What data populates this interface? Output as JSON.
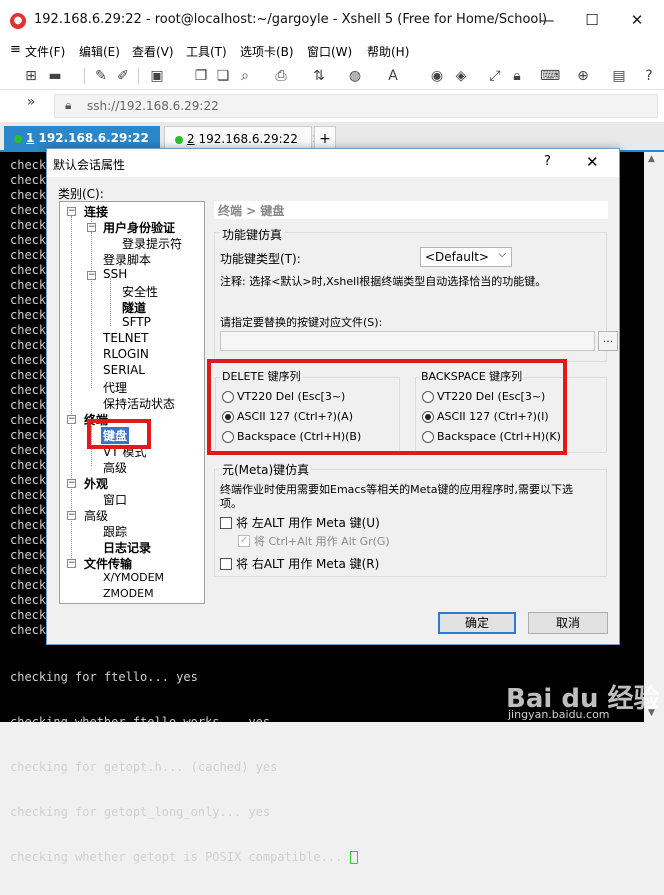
{
  "window": {
    "title": "192.168.6.29:22 - root@localhost:~/gargoyle - Xshell 5 (Free for Home/School)",
    "min": "—",
    "max": "☐",
    "close": "✕"
  },
  "menu": [
    "文件(F)",
    "编辑(E)",
    "查看(V)",
    "工具(T)",
    "选项卡(B)",
    "窗口(W)",
    "帮助(H)"
  ],
  "address": {
    "value": "ssh://192.168.6.29:22"
  },
  "tabs": [
    {
      "num": "1",
      "label": "192.168.6.29:22",
      "close": "✕"
    },
    {
      "num": "2",
      "label": "192.168.6.29:22",
      "close": "✕"
    }
  ],
  "tab_add": "+",
  "terminal": {
    "left_word": "check",
    "bottom_lines": [
      "checking for ftello... yes",
      "checking whether ftello works... yes",
      "checking for getopt.h... (cached) yes",
      "checking for getopt_long_only... yes",
      "checking whether getopt is POSIX compatible... "
    ]
  },
  "dialog": {
    "title": "默认会话属性",
    "help": "?",
    "close": "✕",
    "category_label": "类别(C):",
    "tree": {
      "connect": "连接",
      "auth": "用户身份验证",
      "login_prompt": "登录提示符",
      "login_script": "登录脚本",
      "ssh": "SSH",
      "security": "安全性",
      "tunnel": "隧道",
      "sftp": "SFTP",
      "telnet": "TELNET",
      "rlogin": "RLOGIN",
      "serial": "SERIAL",
      "proxy": "代理",
      "keepalive": "保持活动状态",
      "terminal": "终端",
      "keyboard": "键盘",
      "vt_mode": "VT 模式",
      "advanced1": "高级",
      "appearance": "外观",
      "window": "窗口",
      "advanced": "高级",
      "trace": "跟踪",
      "logging": "日志记录",
      "file_transfer": "文件传输",
      "xymodem": "X/YMODEM",
      "zmodem": "ZMODEM"
    },
    "breadcrumb": "终端 > 键盘",
    "fn_key_group": "功能键仿真",
    "fn_key_type_label": "功能键类型(T):",
    "fn_key_type_value": "<Default>",
    "fn_note": "注释: 选择<默认>时,Xshell根据终端类型自动选择恰当的功能键。",
    "keymap_label": "请指定要替换的按键对应文件(S):",
    "browse": "...",
    "delete_group": "DELETE 键序列",
    "delete_options": [
      "VT220 Del (Esc[3~)",
      "ASCII 127 (Ctrl+?)(A)",
      "Backspace (Ctrl+H)(B)"
    ],
    "backspace_group": "BACKSPACE 键序列",
    "backspace_options": [
      "VT220 Del (Esc[3~)",
      "ASCII 127 (Ctrl+?)(I)",
      "Backspace (Ctrl+H)(K)"
    ],
    "meta_group": "元(Meta)键仿真",
    "meta_note_1": "终端作业时使用需要如Emacs等相关的Meta键的应用程序时,需要以下选",
    "meta_note_2": "项。",
    "meta_left_alt": "将 左ALT 用作 Meta 键(U)",
    "meta_ctrl_alt": "将 Ctrl+Alt 用作 Alt Gr(G)",
    "meta_right_alt": "将 右ALT 用作 Meta 键(R)",
    "ok": "确定",
    "cancel": "取消"
  },
  "watermark": {
    "brand": "Bai du 经验",
    "url": "jingyan.baidu.com"
  },
  "colors": {
    "tab_active": "#2a87c9",
    "selection": "#3a73c9",
    "highlight": "#e0191c"
  }
}
